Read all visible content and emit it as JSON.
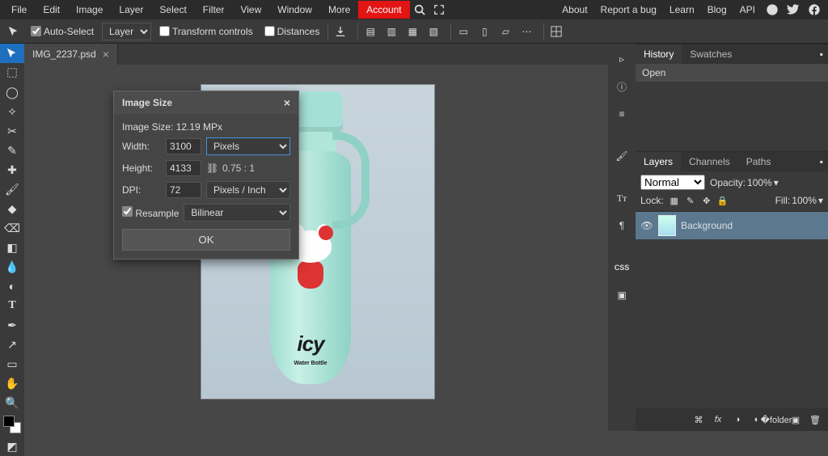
{
  "menubar": {
    "items": [
      "File",
      "Edit",
      "Image",
      "Layer",
      "Select",
      "Filter",
      "View",
      "Window",
      "More",
      "Account"
    ],
    "right": [
      "About",
      "Report a bug",
      "Learn",
      "Blog",
      "API"
    ]
  },
  "optbar": {
    "auto_select": "Auto-Select",
    "layer_select": "Layer",
    "transform": "Transform controls",
    "distances": "Distances"
  },
  "doc": {
    "name": "IMG_2237.psd"
  },
  "canvas": {
    "brand": "icy",
    "brand_sub": "Water Bottle"
  },
  "history": {
    "tabs": [
      "History",
      "Swatches"
    ],
    "row0": "Open"
  },
  "layers": {
    "tabs": [
      "Layers",
      "Channels",
      "Paths"
    ],
    "blend": "Normal",
    "opacity_label": "Opacity:",
    "opacity_val": "100%",
    "lock_label": "Lock:",
    "fill_label": "Fill:",
    "fill_val": "100%",
    "item0": "Background"
  },
  "right_col": {
    "css": "CSS"
  },
  "dlg": {
    "title": "Image Size",
    "size_line": "Image Size: 12.19 MPx",
    "width_lbl": "Width:",
    "width_val": "3100",
    "height_lbl": "Height:",
    "height_val": "4133",
    "units": "Pixels",
    "ratio": "0.75 : 1",
    "dpi_lbl": "DPI:",
    "dpi_val": "72",
    "dpi_units": "Pixels / Inch",
    "resample_lbl": "Resample",
    "resample_method": "Bilinear",
    "ok": "OK"
  }
}
